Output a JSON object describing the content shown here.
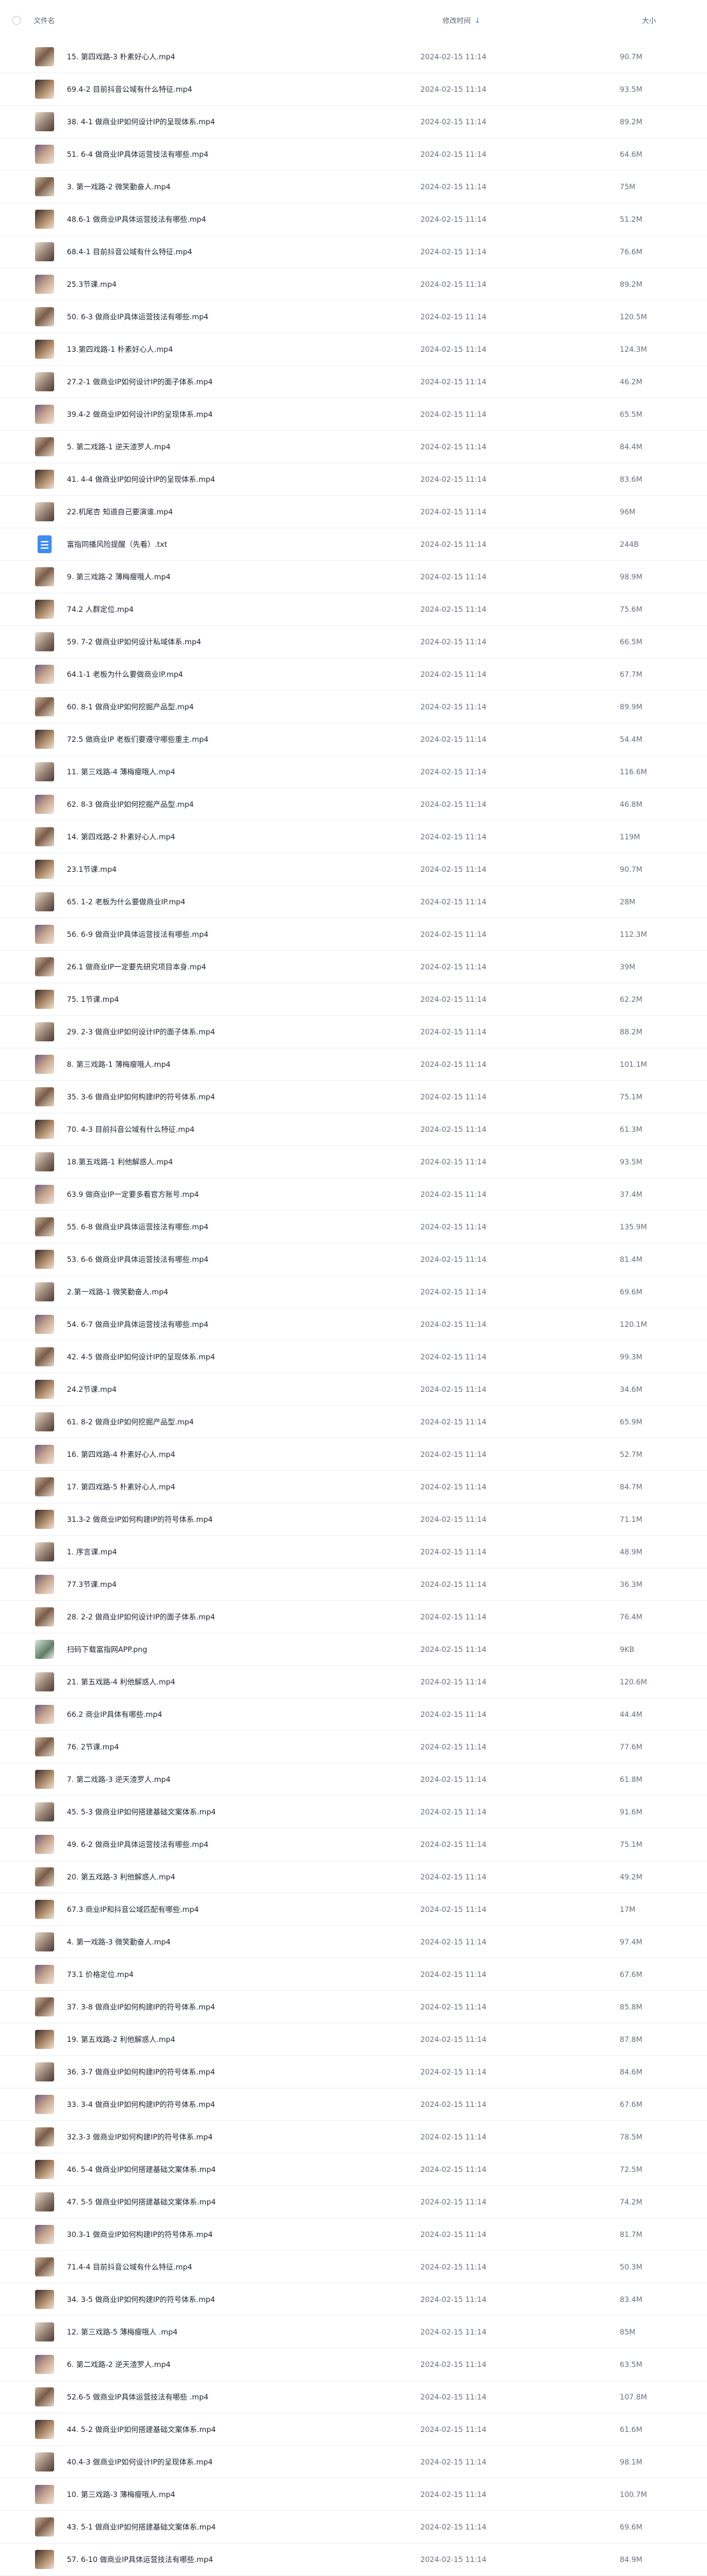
{
  "header": {
    "name_label": "文件名",
    "time_label": "修改时间",
    "size_label": "大小"
  },
  "rows": [
    {
      "name": "15. 第四戏路-3 朴素好心人.mp4",
      "time": "2024-02-15 11:14",
      "size": "90.7M",
      "type": "video"
    },
    {
      "name": "69.4-2 目前抖音公域有什么特征.mp4",
      "time": "2024-02-15 11:14",
      "size": "93.5M",
      "type": "video"
    },
    {
      "name": "38. 4-1 做商业IP如何设计IP的呈现体系.mp4",
      "time": "2024-02-15 11:14",
      "size": "89.2M",
      "type": "video"
    },
    {
      "name": "51. 6-4 做商业IP具体运营技法有哪些.mp4",
      "time": "2024-02-15 11:14",
      "size": "64.6M",
      "type": "video"
    },
    {
      "name": "3. 第一戏路-2 微笑勤奋人.mp4",
      "time": "2024-02-15 11:14",
      "size": "75M",
      "type": "video"
    },
    {
      "name": "48.6-1 做商业IP具体运营技法有哪些.mp4",
      "time": "2024-02-15 11:14",
      "size": "51.2M",
      "type": "video"
    },
    {
      "name": "68.4-1 目前抖音公域有什么特征.mp4",
      "time": "2024-02-15 11:14",
      "size": "76.6M",
      "type": "video"
    },
    {
      "name": "25.3节课.mp4",
      "time": "2024-02-15 11:14",
      "size": "89.2M",
      "type": "video"
    },
    {
      "name": "50. 6-3 做商业IP具体运营技法有哪些.mp4",
      "time": "2024-02-15 11:14",
      "size": "120.5M",
      "type": "video"
    },
    {
      "name": "13.第四戏路-1 朴素好心人.mp4",
      "time": "2024-02-15 11:14",
      "size": "124.3M",
      "type": "video"
    },
    {
      "name": "27.2-1 做商业IP如何设计IP的面子体系.mp4",
      "time": "2024-02-15 11:14",
      "size": "46.2M",
      "type": "video"
    },
    {
      "name": "39.4-2 做商业IP如何设计IP的呈现体系.mp4",
      "time": "2024-02-15 11:14",
      "size": "65.5M",
      "type": "video"
    },
    {
      "name": "5. 第二戏路-1 逆天渣罗人.mp4",
      "time": "2024-02-15 11:14",
      "size": "84.4M",
      "type": "video"
    },
    {
      "name": "41. 4-4 做商业IP如何设计IP的呈现体系.mp4",
      "time": "2024-02-15 11:14",
      "size": "83.6M",
      "type": "video"
    },
    {
      "name": "22.机尾杏 知道自己要演谁.mp4",
      "time": "2024-02-15 11:14",
      "size": "96M",
      "type": "video"
    },
    {
      "name": "富指同播风险提醒（先看）.txt",
      "time": "2024-02-15 11:14",
      "size": "244B",
      "type": "txt"
    },
    {
      "name": "9. 第三戏路-2 薄梅瘦哦人.mp4",
      "time": "2024-02-15 11:14",
      "size": "98.9M",
      "type": "video"
    },
    {
      "name": "74.2 人群定位.mp4",
      "time": "2024-02-15 11:14",
      "size": "75.6M",
      "type": "video"
    },
    {
      "name": "59. 7-2 做商业IP如何设计私域体系.mp4",
      "time": "2024-02-15 11:14",
      "size": "66.5M",
      "type": "video"
    },
    {
      "name": "64.1-1 老板为什么要做商业IP.mp4",
      "time": "2024-02-15 11:14",
      "size": "67.7M",
      "type": "video"
    },
    {
      "name": "60. 8-1 做商业IP如何挖掘产品型.mp4",
      "time": "2024-02-15 11:14",
      "size": "89.9M",
      "type": "video"
    },
    {
      "name": "72.5 做商业IP 老板们要遵守哪些重主.mp4",
      "time": "2024-02-15 11:14",
      "size": "54.4M",
      "type": "video"
    },
    {
      "name": "11. 第三戏路-4 薄梅瘦哦人.mp4",
      "time": "2024-02-15 11:14",
      "size": "116.6M",
      "type": "video"
    },
    {
      "name": "62. 8-3 做商业IP如何挖掘产品型.mp4",
      "time": "2024-02-15 11:14",
      "size": "46.8M",
      "type": "video"
    },
    {
      "name": "14. 第四戏路-2 朴素好心人.mp4",
      "time": "2024-02-15 11:14",
      "size": "119M",
      "type": "video"
    },
    {
      "name": "23.1节课.mp4",
      "time": "2024-02-15 11:14",
      "size": "90.7M",
      "type": "video"
    },
    {
      "name": "65. 1-2 老板为什么要做商业IP.mp4",
      "time": "2024-02-15 11:14",
      "size": "28M",
      "type": "video"
    },
    {
      "name": "56. 6-9 做商业IP具体运营技法有哪些.mp4",
      "time": "2024-02-15 11:14",
      "size": "112.3M",
      "type": "video"
    },
    {
      "name": "26.1 做商业IP一定要先研究项目本身.mp4",
      "time": "2024-02-15 11:14",
      "size": "39M",
      "type": "video"
    },
    {
      "name": "75. 1节课.mp4",
      "time": "2024-02-15 11:14",
      "size": "62.2M",
      "type": "video"
    },
    {
      "name": "29. 2-3 做商业IP如何设计IP的面子体系.mp4",
      "time": "2024-02-15 11:14",
      "size": "88.2M",
      "type": "video"
    },
    {
      "name": "8. 第三戏路-1 薄梅瘦哦人.mp4",
      "time": "2024-02-15 11:14",
      "size": "101.1M",
      "type": "video"
    },
    {
      "name": "35. 3-6 做商业IP如何构建IP的符号体系.mp4",
      "time": "2024-02-15 11:14",
      "size": "75.1M",
      "type": "video"
    },
    {
      "name": "70. 4-3 目前抖音公域有什么特征.mp4",
      "time": "2024-02-15 11:14",
      "size": "61.3M",
      "type": "video"
    },
    {
      "name": "18.第五戏路-1 利他解惑人.mp4",
      "time": "2024-02-15 11:14",
      "size": "93.5M",
      "type": "video"
    },
    {
      "name": "63.9 做商业IP一定要多看官方账号.mp4",
      "time": "2024-02-15 11:14",
      "size": "37.4M",
      "type": "video"
    },
    {
      "name": "55. 6-8 做商业IP具体运营技法有哪些.mp4",
      "time": "2024-02-15 11:14",
      "size": "135.9M",
      "type": "video"
    },
    {
      "name": "53. 6-6 做商业IP具体运营技法有哪些.mp4",
      "time": "2024-02-15 11:14",
      "size": "81.4M",
      "type": "video"
    },
    {
      "name": "2.第一戏路-1 微笑勤奋人.mp4",
      "time": "2024-02-15 11:14",
      "size": "69.6M",
      "type": "video"
    },
    {
      "name": "54. 6-7 做商业IP具体运营技法有哪些.mp4",
      "time": "2024-02-15 11:14",
      "size": "120.1M",
      "type": "video"
    },
    {
      "name": "42. 4-5 做商业IP如何设计IP的呈现体系.mp4",
      "time": "2024-02-15 11:14",
      "size": "99.3M",
      "type": "video"
    },
    {
      "name": "24.2节课.mp4",
      "time": "2024-02-15 11:14",
      "size": "34.6M",
      "type": "video"
    },
    {
      "name": "61. 8-2 做商业IP如何挖掘产品型.mp4",
      "time": "2024-02-15 11:14",
      "size": "65.9M",
      "type": "video"
    },
    {
      "name": "16. 第四戏路-4 朴素好心人.mp4",
      "time": "2024-02-15 11:14",
      "size": "52.7M",
      "type": "video"
    },
    {
      "name": "17. 第四戏路-5 朴素好心人.mp4",
      "time": "2024-02-15 11:14",
      "size": "84.7M",
      "type": "video"
    },
    {
      "name": "31.3-2 做商业IP如何构建IP的符号体系.mp4",
      "time": "2024-02-15 11:14",
      "size": "71.1M",
      "type": "video"
    },
    {
      "name": "1. 序言课.mp4",
      "time": "2024-02-15 11:14",
      "size": "48.9M",
      "type": "video"
    },
    {
      "name": "77.3节课.mp4",
      "time": "2024-02-15 11:14",
      "size": "36.3M",
      "type": "video"
    },
    {
      "name": "28. 2-2 做商业IP如何设计IP的面子体系.mp4",
      "time": "2024-02-15 11:14",
      "size": "76.4M",
      "type": "video"
    },
    {
      "name": "扫码下载富指网APP.png",
      "time": "2024-02-15 11:14",
      "size": "9KB",
      "type": "png"
    },
    {
      "name": "21. 第五戏路-4 利他解惑人.mp4",
      "time": "2024-02-15 11:14",
      "size": "120.6M",
      "type": "video"
    },
    {
      "name": "66.2 商业IP具体有哪些.mp4",
      "time": "2024-02-15 11:14",
      "size": "44.4M",
      "type": "video"
    },
    {
      "name": "76. 2节课.mp4",
      "time": "2024-02-15 11:14",
      "size": "77.6M",
      "type": "video"
    },
    {
      "name": "7. 第二戏路-3 逆天渣罗人.mp4",
      "time": "2024-02-15 11:14",
      "size": "61.8M",
      "type": "video"
    },
    {
      "name": "45. 5-3 做商业IP如何搭建基础文案体系.mp4",
      "time": "2024-02-15 11:14",
      "size": "91.6M",
      "type": "video"
    },
    {
      "name": "49. 6-2 做商业IP具体运营技法有哪些.mp4",
      "time": "2024-02-15 11:14",
      "size": "75.1M",
      "type": "video"
    },
    {
      "name": "20. 第五戏路-3 利他解惑人.mp4",
      "time": "2024-02-15 11:14",
      "size": "49.2M",
      "type": "video"
    },
    {
      "name": "67.3 商业IP和抖音公域匹配有哪些.mp4",
      "time": "2024-02-15 11:14",
      "size": "17M",
      "type": "video"
    },
    {
      "name": "4. 第一戏路-3 微笑勤奋人.mp4",
      "time": "2024-02-15 11:14",
      "size": "97.4M",
      "type": "video"
    },
    {
      "name": "73.1 价格定位.mp4",
      "time": "2024-02-15 11:14",
      "size": "67.6M",
      "type": "video"
    },
    {
      "name": "37. 3-8 做商业IP如何构建IP的符号体系.mp4",
      "time": "2024-02-15 11:14",
      "size": "85.8M",
      "type": "video"
    },
    {
      "name": "19. 第五戏路-2 利他解惑人.mp4",
      "time": "2024-02-15 11:14",
      "size": "87.8M",
      "type": "video"
    },
    {
      "name": "36. 3-7 做商业IP如何构建IP的符号体系.mp4",
      "time": "2024-02-15 11:14",
      "size": "84.6M",
      "type": "video"
    },
    {
      "name": "33. 3-4 做商业IP如何构建IP的符号体系.mp4",
      "time": "2024-02-15 11:14",
      "size": "67.6M",
      "type": "video"
    },
    {
      "name": "32.3-3 做商业IP如何构建IP的符号体系.mp4",
      "time": "2024-02-15 11:14",
      "size": "78.5M",
      "type": "video"
    },
    {
      "name": "46. 5-4 做商业IP如何搭建基础文案体系.mp4",
      "time": "2024-02-15 11:14",
      "size": "72.5M",
      "type": "video"
    },
    {
      "name": "47. 5-5 做商业IP如何搭建基础文案体系.mp4",
      "time": "2024-02-15 11:14",
      "size": "74.2M",
      "type": "video"
    },
    {
      "name": "30.3-1 做商业IP如何构建IP的符号体系.mp4",
      "time": "2024-02-15 11:14",
      "size": "81.7M",
      "type": "video"
    },
    {
      "name": "71.4-4 目前抖音公域有什么特征.mp4",
      "time": "2024-02-15 11:14",
      "size": "50.3M",
      "type": "video"
    },
    {
      "name": "34. 3-5 做商业IP如何构建IP的符号体系.mp4",
      "time": "2024-02-15 11:14",
      "size": "83.4M",
      "type": "video"
    },
    {
      "name": "12. 第三戏路-5 薄梅瘦哦人 .mp4",
      "time": "2024-02-15 11:14",
      "size": "85M",
      "type": "video"
    },
    {
      "name": "6. 第二戏路-2 逆天渣罗人.mp4",
      "time": "2024-02-15 11:14",
      "size": "63.5M",
      "type": "video"
    },
    {
      "name": "52.6-5 做商业IP具体运营技法有哪些 .mp4",
      "time": "2024-02-15 11:14",
      "size": "107.8M",
      "type": "video"
    },
    {
      "name": "44. 5-2 做商业IP如何搭建基础文案体系.mp4",
      "time": "2024-02-15 11:14",
      "size": "61.6M",
      "type": "video"
    },
    {
      "name": "40.4-3 做商业IP如何设计IP的呈现体系.mp4",
      "time": "2024-02-15 11:14",
      "size": "98.1M",
      "type": "video"
    },
    {
      "name": "10. 第三戏路-3 薄梅瘦哦人.mp4",
      "time": "2024-02-15 11:14",
      "size": "100.7M",
      "type": "video"
    },
    {
      "name": "43. 5-1 做商业IP如何搭建基础文案体系.mp4",
      "time": "2024-02-15 11:14",
      "size": "69.6M",
      "type": "video"
    },
    {
      "name": "57. 6-10 做商业IP具体运营技法有哪些.mp4",
      "time": "2024-02-15 11:14",
      "size": "84.9M",
      "type": "video"
    }
  ]
}
